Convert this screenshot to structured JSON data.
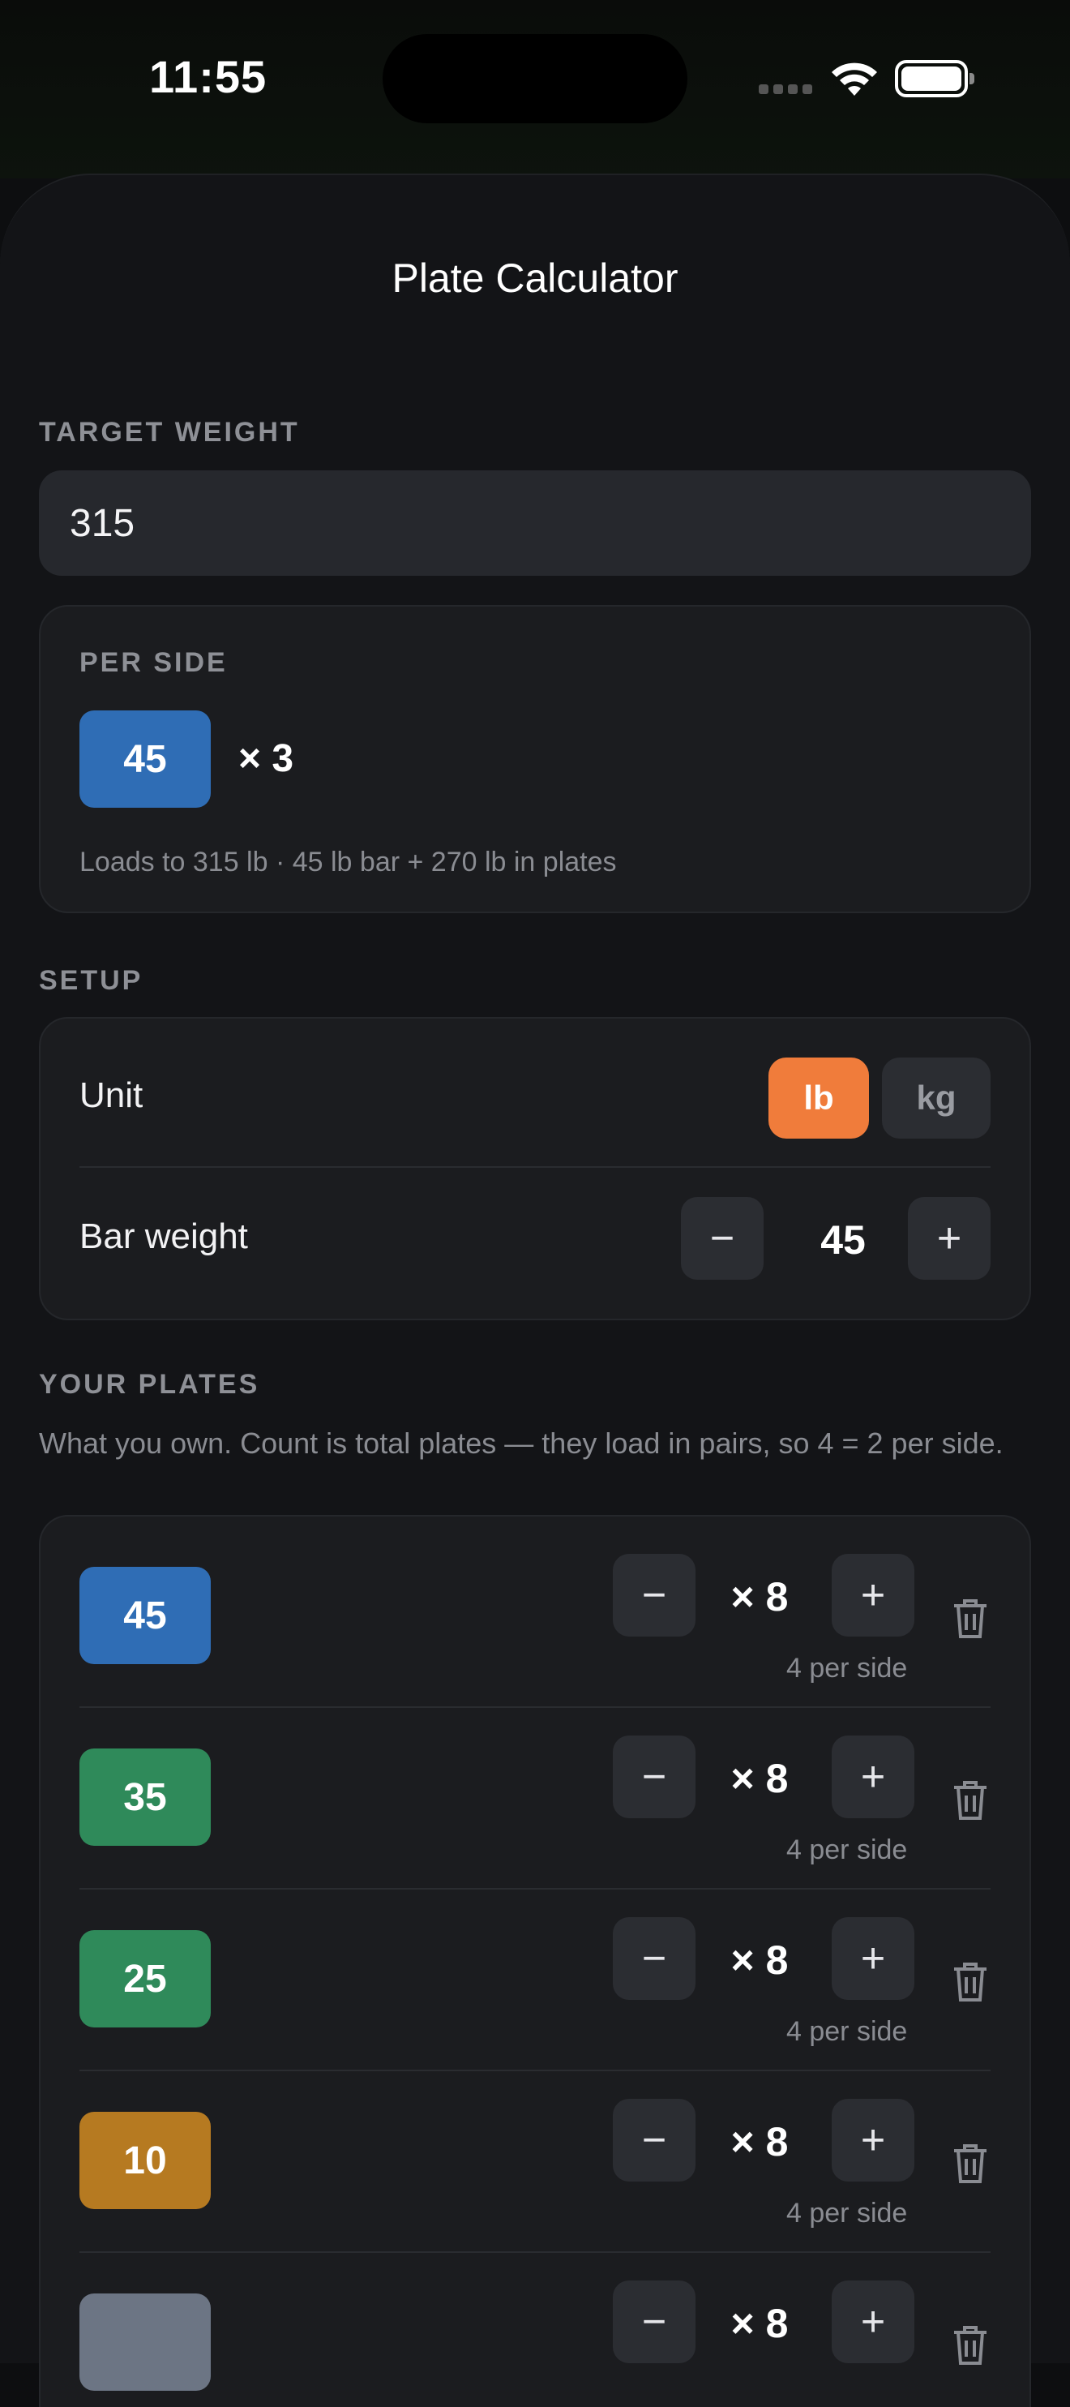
{
  "status": {
    "time": "11:55"
  },
  "nav": {
    "title": "Plate Calculator"
  },
  "target": {
    "label": "TARGET WEIGHT",
    "value": "315"
  },
  "per_side": {
    "label": "PER SIDE",
    "plate": "45",
    "count": "× 3",
    "summary": "Loads to 315 lb · 45 lb bar + 270 lb in plates"
  },
  "setup": {
    "label": "SETUP",
    "unit_label": "Unit",
    "unit_options": [
      "lb",
      "kg"
    ],
    "unit_selected": "lb",
    "bar_label": "Bar weight",
    "bar_value": "45",
    "minus": "−",
    "plus": "+"
  },
  "plates": {
    "label": "YOUR PLATES",
    "description": "What you own. Count is total plates — they load in pairs, so 4 = 2 per side.",
    "items": [
      {
        "weight": "45",
        "count": "× 8",
        "per_side": "4 per side",
        "color": "#2f6db5"
      },
      {
        "weight": "35",
        "count": "× 8",
        "per_side": "4 per side",
        "color": "#2f8a5a"
      },
      {
        "weight": "25",
        "count": "× 8",
        "per_side": "4 per side",
        "color": "#2f8a5a"
      },
      {
        "weight": "10",
        "count": "× 8",
        "per_side": "4 per side",
        "color": "#b67a21"
      },
      {
        "weight": "",
        "count": "× 8",
        "per_side": "",
        "color": "#6c7584"
      }
    ]
  },
  "colors": {
    "accent": "#f07c3b",
    "background": "#131417",
    "card": "#1b1c1f"
  }
}
